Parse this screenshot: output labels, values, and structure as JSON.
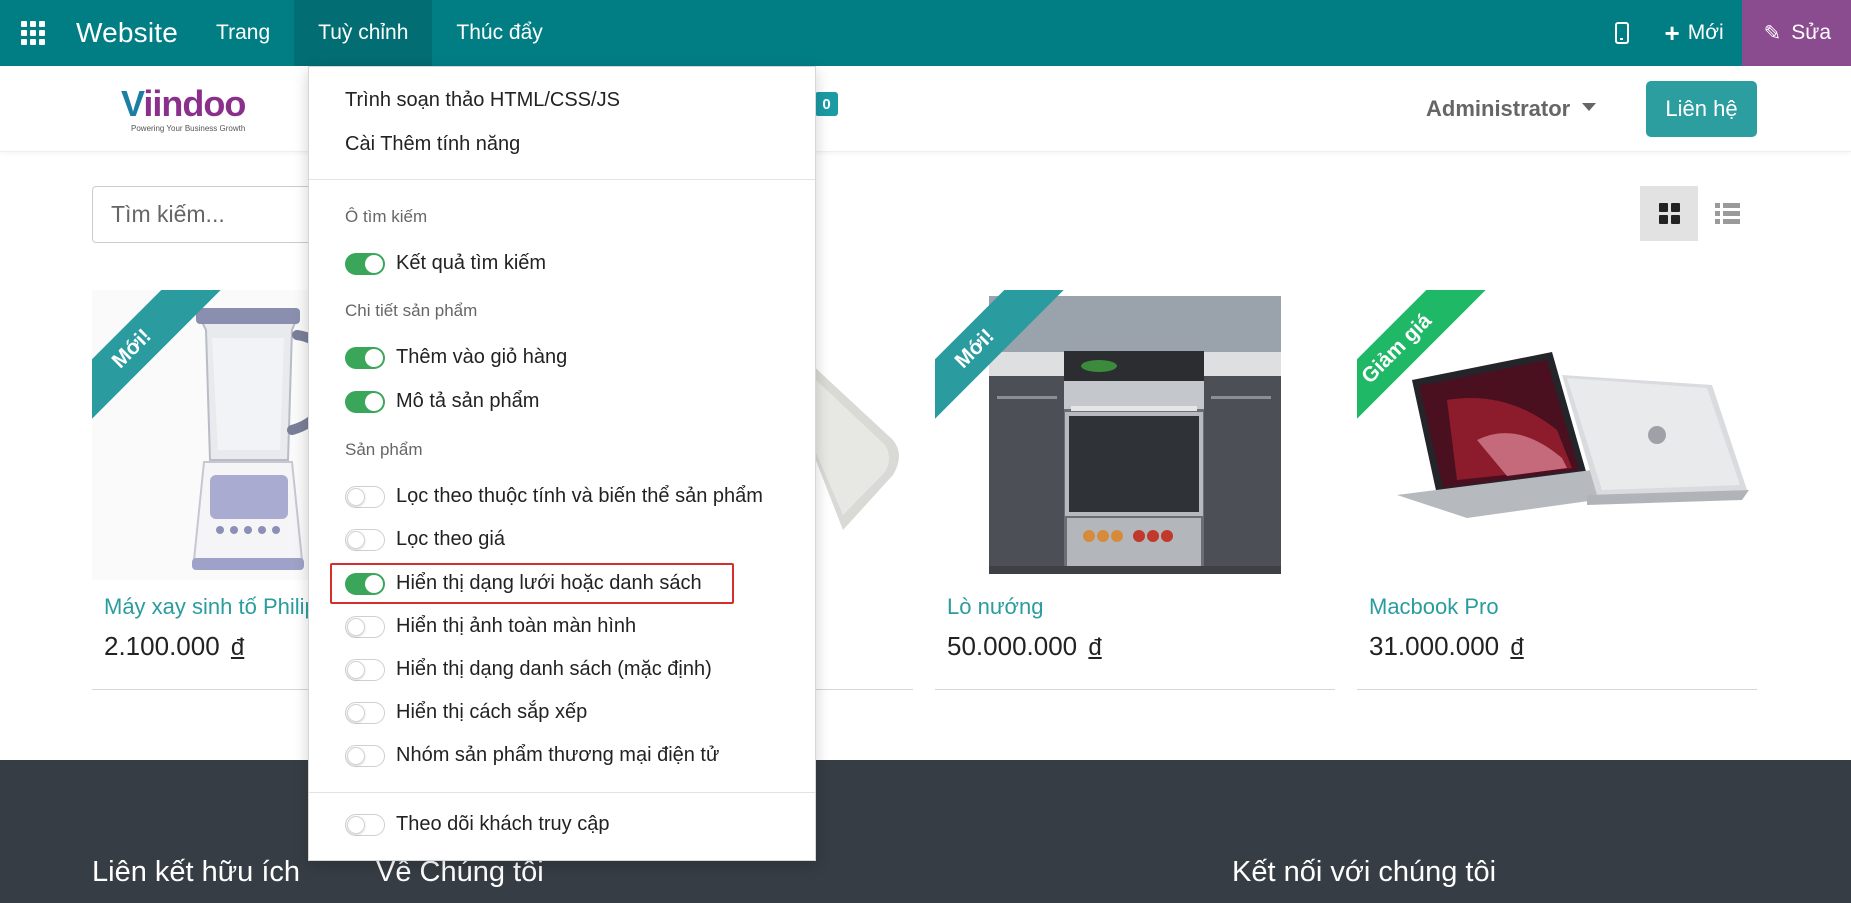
{
  "navbar": {
    "brand": "Website",
    "menus": [
      "Trang",
      "Tuỳ chỉnh",
      "Thúc đẩy"
    ],
    "new_label": "Mới",
    "edit_label": "Sửa",
    "bg_color": "#017e84",
    "edit_color": "#8a4b8f"
  },
  "site_header": {
    "logo_text_v": "V",
    "logo_text_rest": "iindoo",
    "logo_tagline": "Powering Your Business Growth",
    "cart_count": "0",
    "user_name": "Administrator",
    "contact_label": "Liên hệ"
  },
  "search": {
    "placeholder": "Tìm kiếm..."
  },
  "products": [
    {
      "name": "Máy xay sinh tố Philips",
      "price": "2.100.000",
      "currency": "đ",
      "ribbon": "Mới!"
    },
    {
      "name": "",
      "price": "",
      "currency": "",
      "ribbon": ""
    },
    {
      "name": "Lò nướng",
      "price": "50.000.000",
      "currency": "đ",
      "ribbon": "Mới!"
    },
    {
      "name": "Macbook Pro",
      "price": "31.000.000",
      "currency": "đ",
      "ribbon": "Giảm giá"
    }
  ],
  "footer": {
    "col1": "Liên kết hữu ích",
    "col2": "Về Chúng tôi",
    "col3": "Kết nối với chúng tôi"
  },
  "dropdown": {
    "links": [
      "Trình soạn thảo HTML/CSS/JS",
      "Cài Thêm tính năng"
    ],
    "section_search": "Ô tìm kiếm",
    "opt_search_results": "Kết quả tìm kiếm",
    "section_product_detail": "Chi tiết sản phẩm",
    "opt_add_to_cart": "Thêm vào giỏ hàng",
    "opt_product_description": "Mô tả sản phẩm",
    "section_products": "Sản phẩm",
    "opt_filter_attributes": "Lọc theo thuộc tính và biến thể sản phẩm",
    "opt_filter_price": "Lọc theo giá",
    "opt_grid_or_list": "Hiển thị dạng lưới hoặc danh sách",
    "opt_fullscreen_images": "Hiển thị ảnh toàn màn hình",
    "opt_list_default": "Hiển thị dạng danh sách (mặc định)",
    "opt_show_sorting": "Hiển thị cách sắp xếp",
    "opt_ecommerce_categories": "Nhóm sản phẩm thương mại điện tử",
    "opt_track_visitors": "Theo dõi khách truy cập",
    "toggle_states": {
      "search_results": true,
      "add_to_cart": true,
      "product_description": true,
      "filter_attributes": false,
      "filter_price": false,
      "grid_or_list": true,
      "fullscreen_images": false,
      "list_default": false,
      "show_sorting": false,
      "ecommerce_categories": false,
      "track_visitors": false
    }
  }
}
